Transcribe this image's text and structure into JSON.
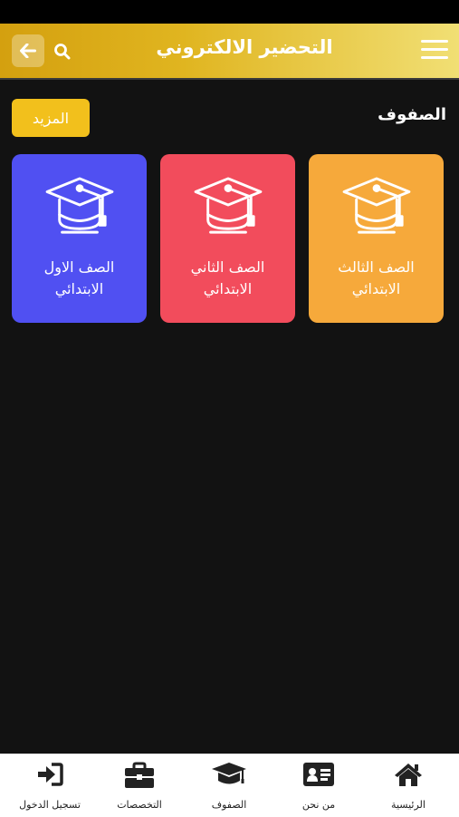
{
  "header": {
    "title": "التحضير الالكتروني",
    "back_icon": "arrow-left-icon",
    "search_icon": "search-icon",
    "menu_icon": "hamburger-menu-icon"
  },
  "section": {
    "title": "الصفوف",
    "more_label": "المزيد"
  },
  "cards": [
    {
      "line1": "الصف الاول",
      "line2": "الابتدائي",
      "color": "#5050f2",
      "icon": "graduation-cap-icon"
    },
    {
      "line1": "الصف الثاني",
      "line2": "الابتدائي",
      "color": "#f24c5c",
      "icon": "graduation-cap-icon"
    },
    {
      "line1": "الصف الثالث",
      "line2": "الابتدائي",
      "color": "#f6a93b",
      "icon": "graduation-cap-icon"
    }
  ],
  "bottom_nav": [
    {
      "label": "تسجيل الدخول",
      "icon": "login-icon"
    },
    {
      "label": "التخصصات",
      "icon": "briefcase-icon"
    },
    {
      "label": "الصفوف",
      "icon": "graduation-cap-icon"
    },
    {
      "label": "من نحن",
      "icon": "id-card-icon"
    },
    {
      "label": "الرئيسية",
      "icon": "home-icon"
    }
  ],
  "colors": {
    "accent": "#f2c01c",
    "header_start": "#d4a00f",
    "header_end": "#f1df74",
    "background": "#121212"
  }
}
